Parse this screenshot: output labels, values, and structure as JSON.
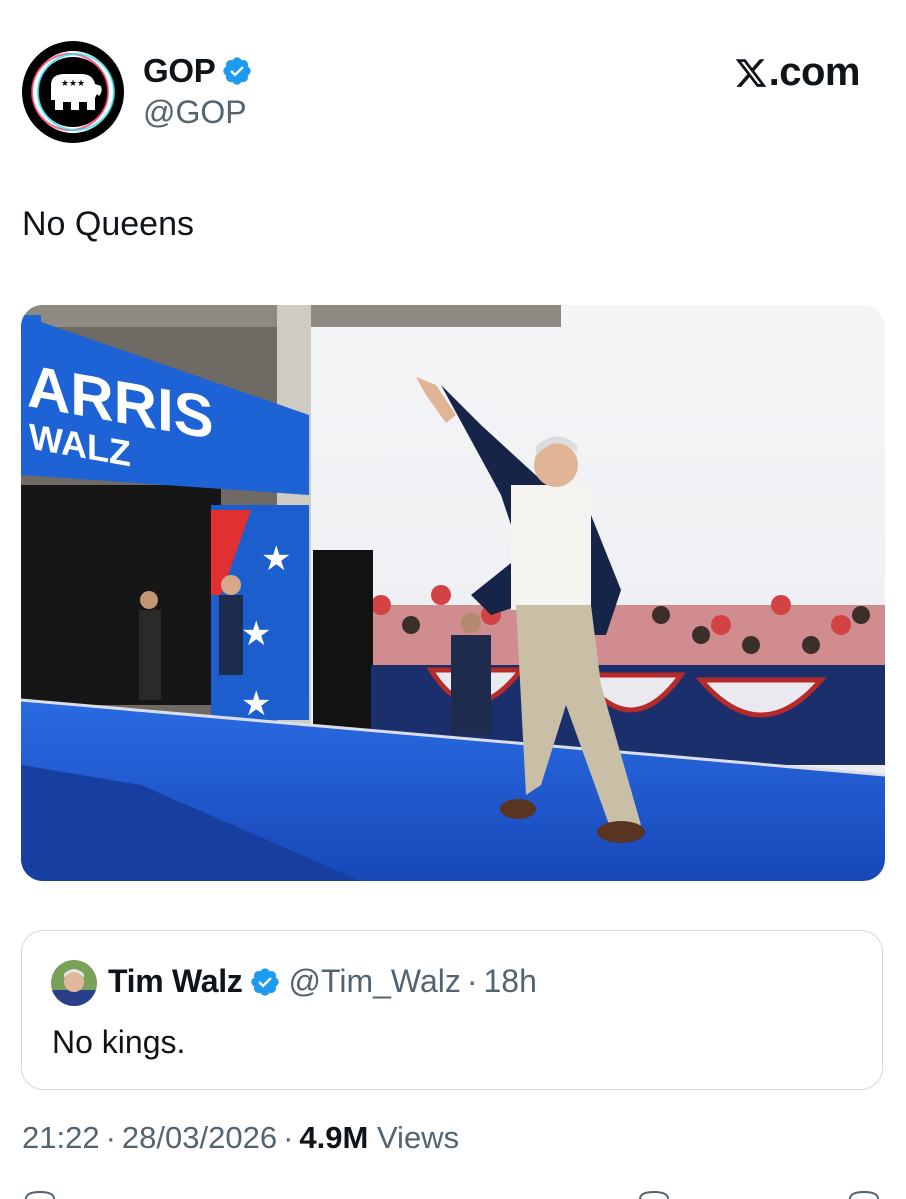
{
  "post": {
    "author": {
      "display_name": "GOP",
      "handle": "@GOP",
      "verified": true,
      "avatar_icon": "elephant-logo-icon"
    },
    "brand": "X.com",
    "text": "No Queens",
    "media": {
      "sign_line1": "ARRIS",
      "sign_line2": "WALZ"
    },
    "quoted": {
      "display_name": "Tim Walz",
      "handle": "@Tim_Walz",
      "separator": "·",
      "time": "18h",
      "text": "No kings.",
      "verified": true
    },
    "meta": {
      "time": "21:22",
      "separator": "·",
      "date": "28/03/2026",
      "views_count": "4.9M",
      "views_label": "Views"
    }
  },
  "colors": {
    "verified_blue": "#1d9bf0",
    "secondary_text": "#536471",
    "stage_blue": "#1f5fd8"
  }
}
